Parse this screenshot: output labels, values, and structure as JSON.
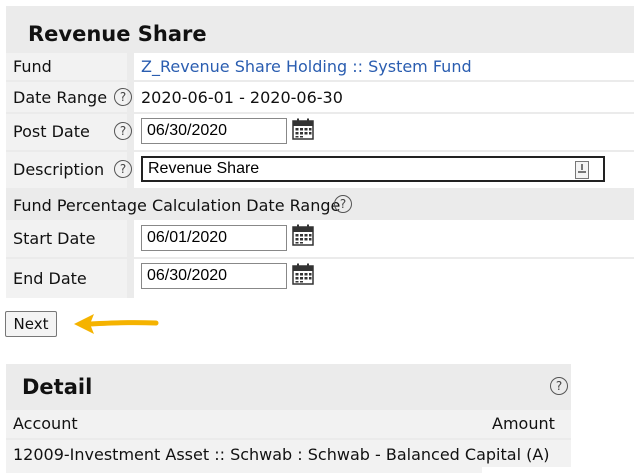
{
  "form": {
    "title": "Revenue Share",
    "fund": {
      "label": "Fund",
      "value": "Z_Revenue Share Holding :: System Fund"
    },
    "date_range": {
      "label": "Date Range",
      "value": "2020-06-01 - 2020-06-30"
    },
    "post_date": {
      "label": "Post Date",
      "value": "06/30/2020"
    },
    "description": {
      "label": "Description",
      "value": "Revenue Share"
    },
    "fund_pct_header": "Fund Percentage Calculation Date Range",
    "start_date": {
      "label": "Start Date",
      "value": "06/01/2020"
    },
    "end_date": {
      "label": "End Date",
      "value": "06/30/2020"
    },
    "help_glyph": "?",
    "next_label": "Next",
    "arrow_color": "#f5b300"
  },
  "detail": {
    "title": "Detail",
    "columns": [
      "Account",
      "Amount"
    ],
    "rows": [
      {
        "account": "12009-Investment Asset :: Schwab : Schwab - Balanced Capital (A)",
        "amount": ""
      }
    ]
  },
  "icons": {
    "calendar": "calendar-icon",
    "help": "help-icon",
    "field_action": "form-field-icon"
  }
}
